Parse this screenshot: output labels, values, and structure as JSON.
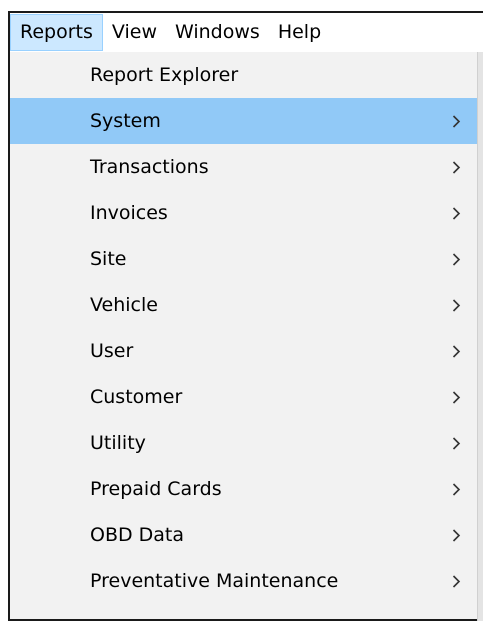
{
  "menubar": {
    "items": [
      {
        "label": "Reports",
        "active": true
      },
      {
        "label": "View",
        "active": false
      },
      {
        "label": "Windows",
        "active": false
      },
      {
        "label": "Help",
        "active": false
      }
    ]
  },
  "reports_menu": {
    "items": [
      {
        "label": "Report Explorer",
        "submenu": false,
        "icon": null
      },
      {
        "label": "System",
        "submenu": true,
        "icon": "chevron-right-icon",
        "highlighted": true
      },
      {
        "label": "Transactions",
        "submenu": true,
        "icon": "chevron-right-icon"
      },
      {
        "label": "Invoices",
        "submenu": true,
        "icon": "chevron-right-icon"
      },
      {
        "label": "Site",
        "submenu": true,
        "icon": "chevron-right-icon"
      },
      {
        "label": "Vehicle",
        "submenu": true,
        "icon": "chevron-right-icon"
      },
      {
        "label": "User",
        "submenu": true,
        "icon": "chevron-right-icon"
      },
      {
        "label": "Customer",
        "submenu": true,
        "icon": "chevron-right-icon"
      },
      {
        "label": "Utility",
        "submenu": true,
        "icon": "chevron-right-icon"
      },
      {
        "label": "Prepaid Cards",
        "submenu": true,
        "icon": "chevron-right-icon"
      },
      {
        "label": "OBD Data",
        "submenu": true,
        "icon": "chevron-right-icon"
      },
      {
        "label": "Preventative Maintenance",
        "submenu": true,
        "icon": "chevron-right-icon"
      }
    ]
  },
  "colors": {
    "highlight": "#91c9f7",
    "menubar_active": "#cce8ff",
    "menu_background": "#f2f2f2"
  }
}
